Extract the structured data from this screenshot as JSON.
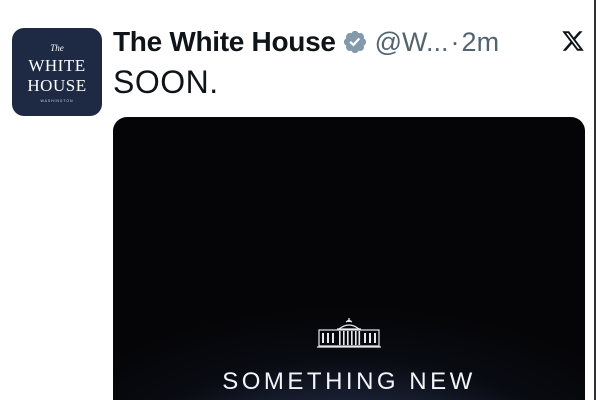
{
  "post": {
    "avatar": {
      "line1": "The",
      "line2": "WHITE",
      "line3": "HOUSE",
      "line4": "WASHINGTON"
    },
    "author": {
      "display_name": "The White House",
      "verified": true,
      "handle": "@W...",
      "separator": "·",
      "time_ago": "2m"
    },
    "platform_icon": "x-logo-icon",
    "text": "SOON.",
    "media": {
      "icon": "white-house-building-icon",
      "caption": "SOMETHING NEW"
    }
  },
  "colors": {
    "name": "#0f1419",
    "secondary": "#536471",
    "avatar_bg": "#1e2a44",
    "media_bg": "#050507",
    "verified_badge": "#829aab"
  }
}
